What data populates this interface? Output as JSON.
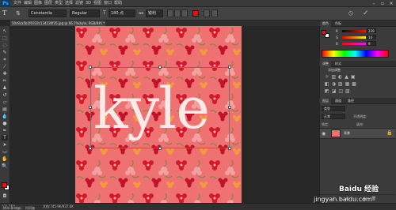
{
  "app": {
    "logo": "Ps",
    "menus": [
      "文件",
      "编辑",
      "图像",
      "图层",
      "类型",
      "选择",
      "滤镜",
      "3D",
      "视图",
      "窗口",
      "帮助"
    ],
    "window_controls": [
      "minimize-icon",
      "restore-icon",
      "close-icon"
    ]
  },
  "options": {
    "font_family": "Constantia",
    "font_style": "Regular",
    "font_size": "180 点",
    "antialias": "锐利"
  },
  "document": {
    "tab_title": "50c8ca5b1f0333c134230f35.jpg @ 66.7%(kyle, RGB/8#) *",
    "text": "kyle",
    "zoom": "131.75%",
    "doc_info": "文档:745.9K/937.6K"
  },
  "status": {
    "mini_bridge": "Mini Bridge",
    "timeline": "时间轴"
  },
  "color_panel": {
    "tabs": [
      "颜色",
      "色板"
    ],
    "rows": [
      {
        "label": "R",
        "value": "239"
      },
      {
        "label": "G",
        "value": "14"
      },
      {
        "label": "B",
        "value": "9"
      }
    ],
    "foreground": "#ef0e09",
    "background": "#ffffff"
  },
  "adjust_panel": {
    "tabs": [
      "调整",
      "样式"
    ],
    "label": "添加调整"
  },
  "layers_panel": {
    "tabs": [
      "图层",
      "通道",
      "路径"
    ],
    "kind_label": "类型",
    "blend_mode": "正常",
    "opacity_label": "不透明度:",
    "lock_label": "锁定:",
    "fill_label": "填充:",
    "layer_name": "背景"
  },
  "watermark": {
    "brand": "Baidu 经验",
    "url": "jingyan.baidu.com"
  },
  "colors": {
    "canvas": "#ef7272",
    "accent": "#31a8ff"
  }
}
